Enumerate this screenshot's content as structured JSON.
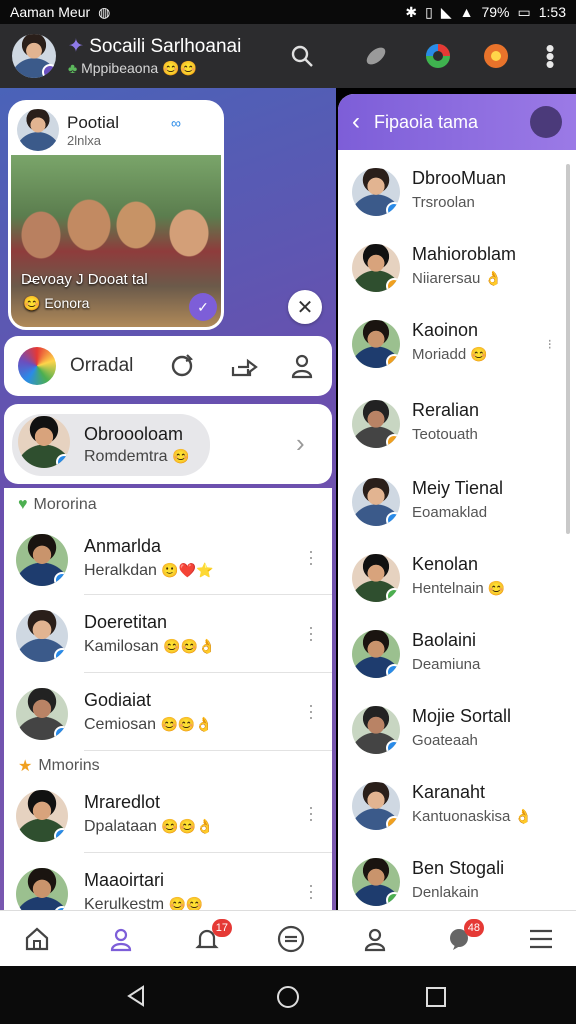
{
  "status_bar": {
    "carrier": "Aaman Meur",
    "battery": "79%",
    "time": "1:53"
  },
  "header": {
    "title": "Socaili Sarlhoanai",
    "subtitle": "Mppibeaona"
  },
  "story": {
    "name": "Pootial",
    "meta": "2lnlxa",
    "caption": "D̶evoay J Dooat tal",
    "chip": "Eonora"
  },
  "action_bar": {
    "label": "Orradal"
  },
  "profile_card": {
    "name": "Obroooloam",
    "status": "Romdemtra"
  },
  "left_list": {
    "section1": "Mororina",
    "section2": "Mmorins",
    "rows": [
      {
        "name": "Anmarlda",
        "status": "Heralkdan",
        "emoji": "🙂❤️⭐"
      },
      {
        "name": "Doeretitan",
        "status": "Kamilosan",
        "emoji": "😊😊👌"
      },
      {
        "name": "Godiaiat",
        "status": "Cemiosan",
        "emoji": "😊😊👌"
      },
      {
        "name": "Mraredlot",
        "status": "Dpalataan",
        "emoji": "😊😊👌"
      },
      {
        "name": "Maaoirtari",
        "status": "Kerulkestm",
        "emoji": "😊😊"
      }
    ]
  },
  "right_panel": {
    "title": "Fipaoia tama",
    "rows": [
      {
        "name": "DbrooMuan",
        "status": "Trsroolan",
        "emoji": ""
      },
      {
        "name": "Mahioroblam",
        "status": "Niiarersau",
        "emoji": "👌"
      },
      {
        "name": "Kaoinon",
        "status": "Moriadd",
        "emoji": "😊"
      },
      {
        "name": "Reralian",
        "status": "Teotouath",
        "emoji": ""
      },
      {
        "name": "Meiy Tienal",
        "status": "Eoamaklad",
        "emoji": ""
      },
      {
        "name": "Kenolan",
        "status": "Hentelnain",
        "emoji": "😊"
      },
      {
        "name": "Baolaini",
        "status": "Deamiuna",
        "emoji": ""
      },
      {
        "name": "Mojie Sortall",
        "status": "Goateaah",
        "emoji": ""
      },
      {
        "name": "Karanaht",
        "status": "Kantuonaskisa",
        "emoji": "👌"
      },
      {
        "name": "Ben Stogali",
        "status": "Denlakain",
        "emoji": ""
      }
    ]
  },
  "bottom_nav": {
    "badge_notifications": "17",
    "badge_chat": "48"
  },
  "colors": {
    "accent": "#7d5ed8",
    "header_bg": "#2c2c2e",
    "badge_red": "#e53935"
  }
}
